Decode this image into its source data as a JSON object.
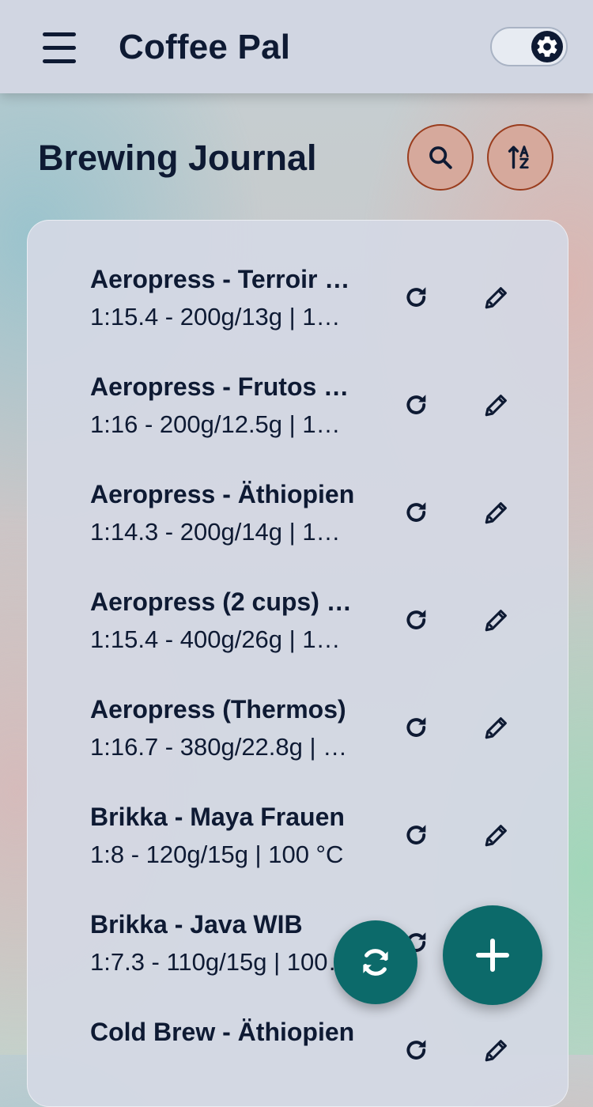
{
  "app": {
    "title": "Coffee Pal"
  },
  "page": {
    "title": "Brewing Journal"
  },
  "colors": {
    "accent": "#0c6a6a",
    "header_bg": "#d1d6e2",
    "action_btn": "#d6a99c",
    "text": "#0e1a33"
  },
  "header": {
    "menu_icon": "menu-icon",
    "theme_toggle_icon": "gear-icon"
  },
  "actions": {
    "search_icon": "search-icon",
    "sort_icon": "sort-alpha-icon"
  },
  "entries": [
    {
      "title": "Aeropress - Terroir Kolumbien",
      "subtitle": "1:15.4 - 200g/13g | 1…"
    },
    {
      "title": "Aeropress - Frutos Rojos",
      "subtitle": "1:16 - 200g/12.5g | 1…"
    },
    {
      "title": "Aeropress - Äthiopien",
      "subtitle": "1:14.3 - 200g/14g | 1…"
    },
    {
      "title": "Aeropress (2 cups) …",
      "subtitle": "1:15.4 - 400g/26g | 1…"
    },
    {
      "title": "Aeropress (Thermos)",
      "subtitle": "1:16.7 - 380g/22.8g | …"
    },
    {
      "title": "Brikka - Maya Frauen",
      "subtitle": "1:8 - 120g/15g | 100 °C"
    },
    {
      "title": "Brikka - Java WIB",
      "subtitle": "1:7.3 - 110g/15g | 100…"
    },
    {
      "title": "Cold Brew - Äthiopien",
      "subtitle": ""
    }
  ],
  "fab": {
    "sync_icon": "sync-icon",
    "add_icon": "plus-icon"
  }
}
